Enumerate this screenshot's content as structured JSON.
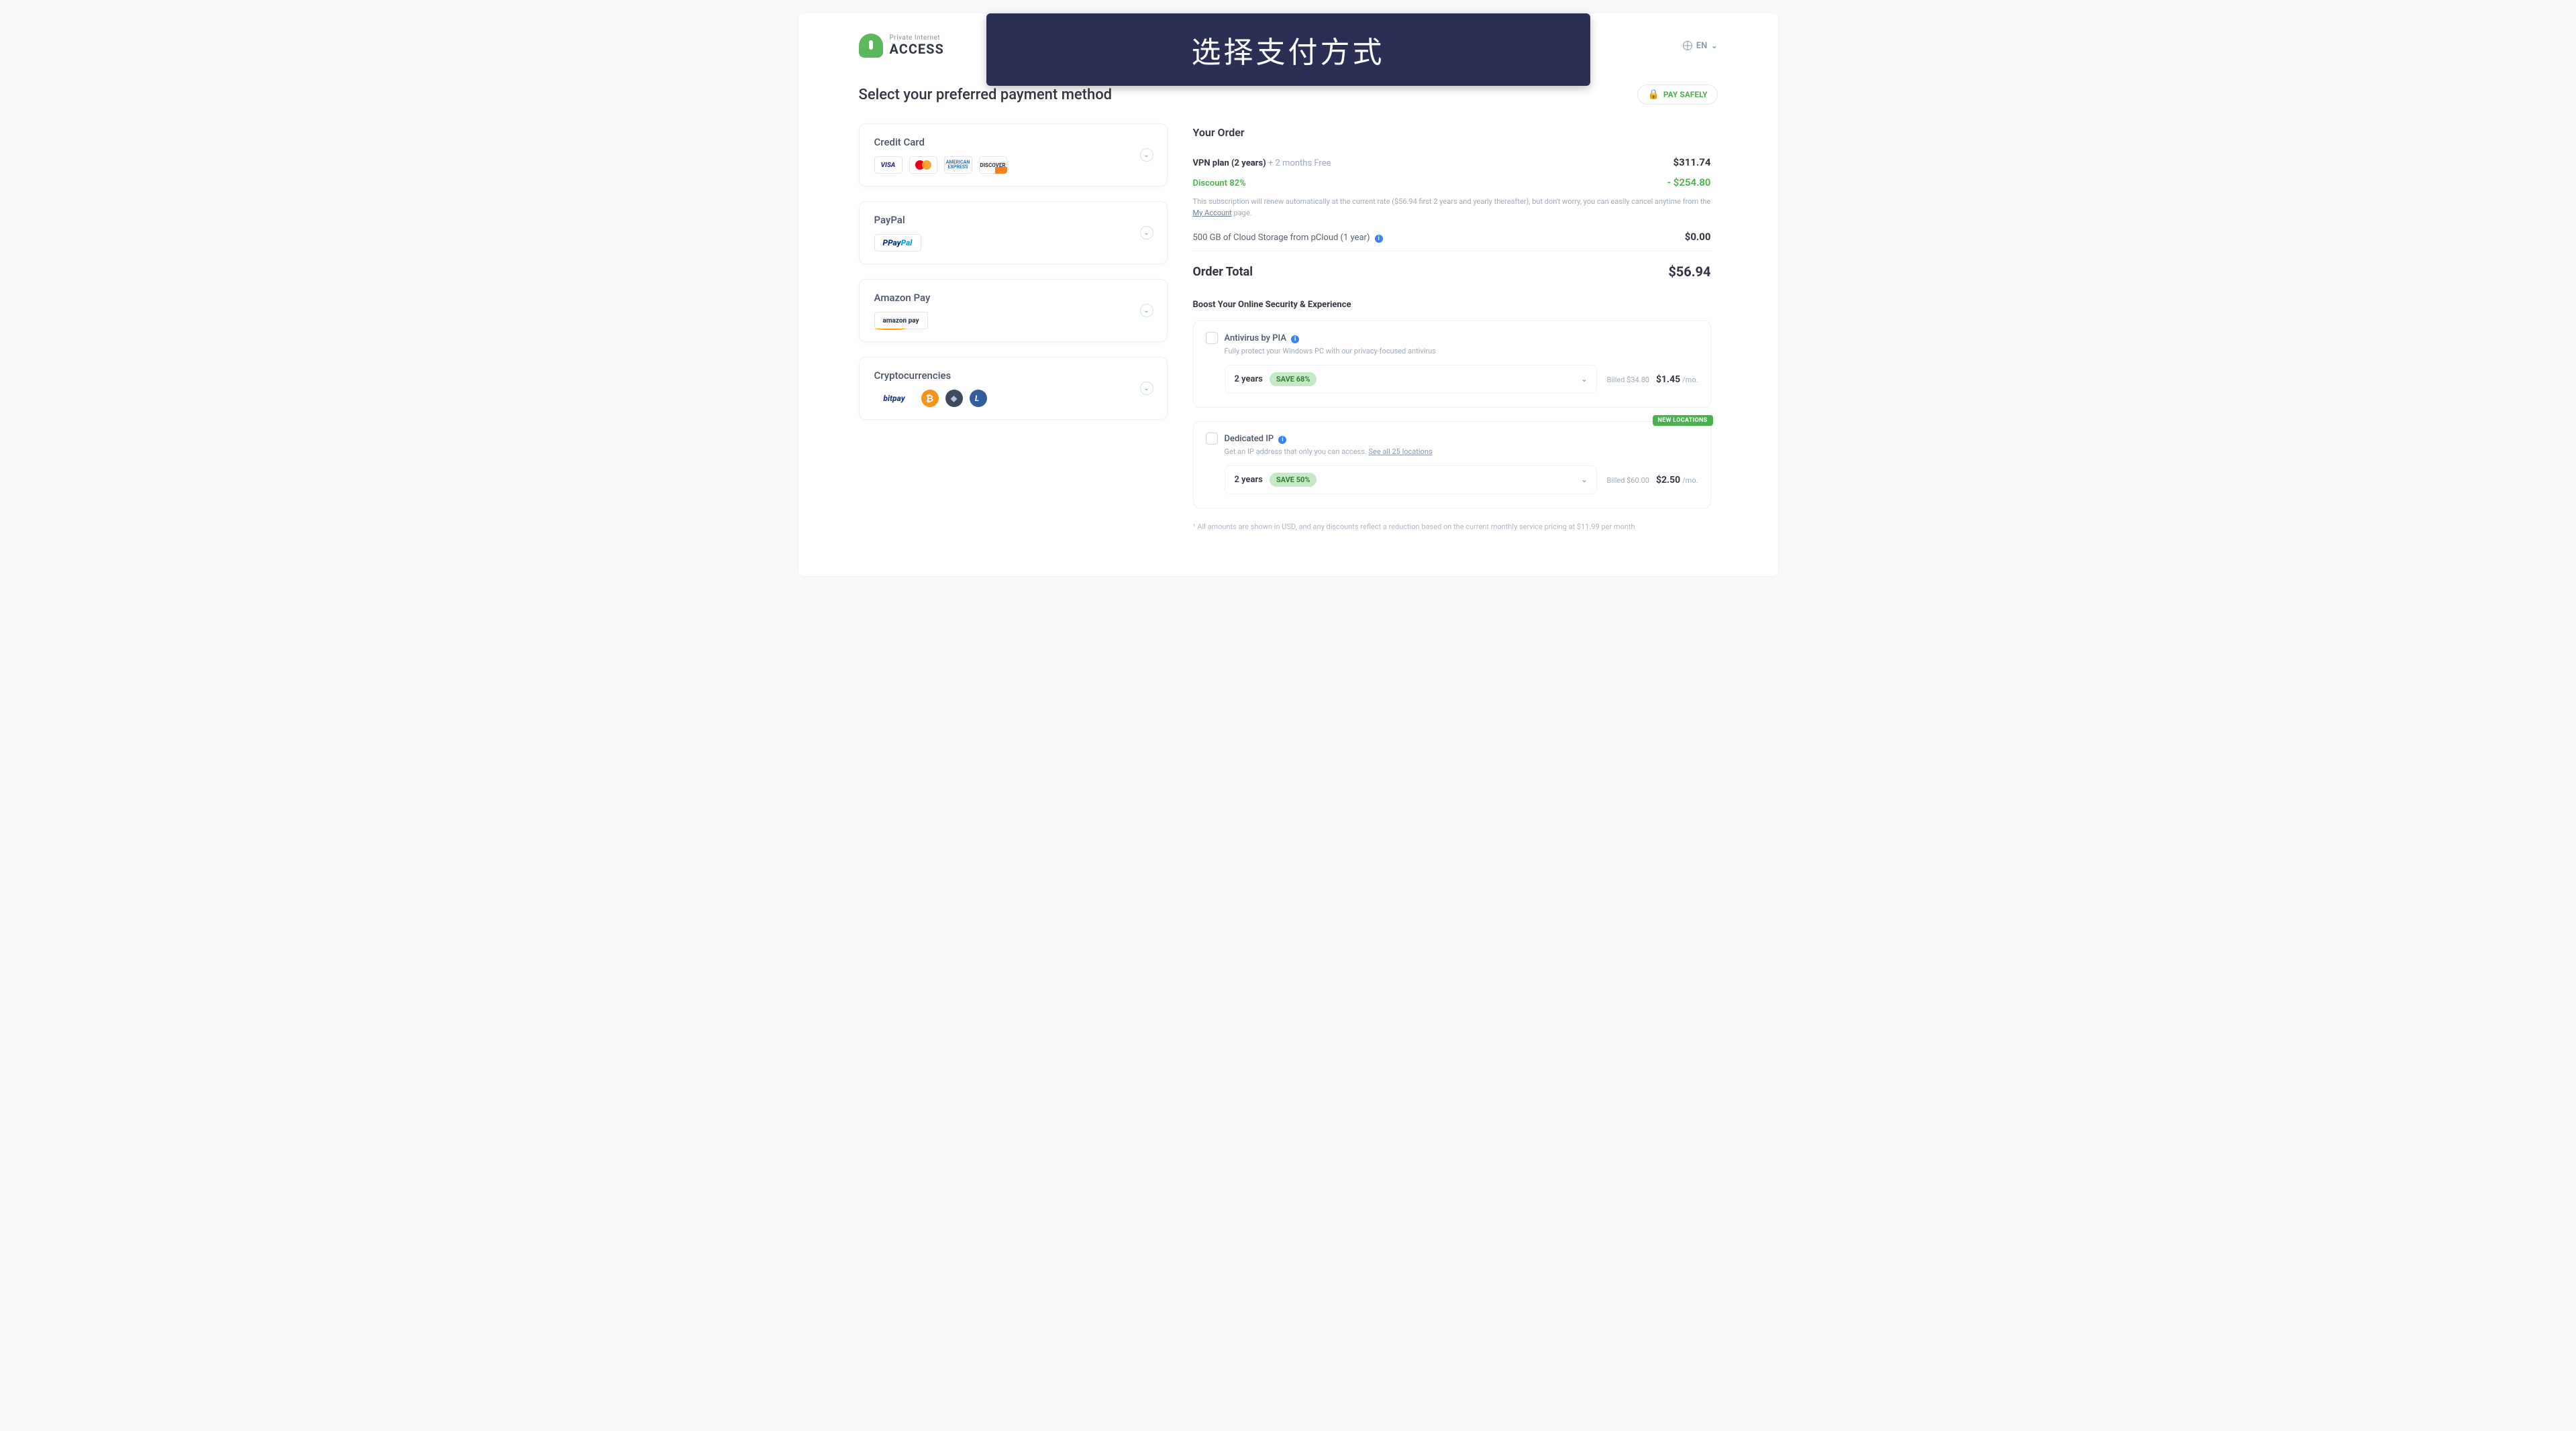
{
  "banner_text": "选择支付方式",
  "logo_small": "Private Internet",
  "logo_big": "ACCESS",
  "lang_label": "EN",
  "page_title": "Select your preferred payment method",
  "pay_safely": "PAY SAFELY",
  "methods": {
    "credit_card": {
      "title": "Credit Card",
      "visa": "VISA",
      "amex": "AMERICAN EXPRESS",
      "discover": "DISCOVER"
    },
    "paypal": {
      "title": "PayPal",
      "brand_p": "P",
      "brand_pay": "Pay",
      "brand_pal": "Pal"
    },
    "amazon": {
      "title": "Amazon Pay",
      "brand": "amazon pay"
    },
    "crypto": {
      "title": "Cryptocurrencies",
      "bitpay": "bitpay",
      "btc": "₿",
      "eth": "◆",
      "ltc": "L"
    }
  },
  "order": {
    "heading": "Your Order",
    "plan_label": "VPN plan (2 years)",
    "plan_bonus": " + 2 months Free",
    "plan_price": "$311.74",
    "discount_label": "Discount 82%",
    "discount_amount": "- $254.80",
    "renew_note_a": "This subscription will renew automatically at the current rate ($56.94 first 2 years and yearly thereafter), but don't worry, you can easily cancel anytime from the ",
    "renew_link": "My Account",
    "renew_note_b": " page.",
    "cloud_label": "500 GB of Cloud Storage from pCloud (1 year)",
    "cloud_price": "$0.00",
    "total_label": "Order Total",
    "total_price": "$56.94",
    "boost_title": "Boost Your Online Security & Experience"
  },
  "addons": {
    "antivirus": {
      "title": "Antivirus by PIA",
      "desc": "Fully protect your Windows PC with our privacy-focused antivirus",
      "term": "2 years",
      "save": "SAVE 68%",
      "billed": "Billed $34.80",
      "price": "$1.45",
      "per": "/mo."
    },
    "dedicated": {
      "badge": "NEW LOCATIONS",
      "title": "Dedicated IP",
      "desc_a": "Get an IP address that only you can access. ",
      "desc_link": "See all 25 locations",
      "term": "2 years",
      "save": "SAVE 50%",
      "billed": "Billed $60.00",
      "price": "$2.50",
      "per": "/mo."
    }
  },
  "footnote": "¹ All amounts are shown in USD, and any discounts reflect a reduction based on the current monthly service pricing at $11.99 per month"
}
